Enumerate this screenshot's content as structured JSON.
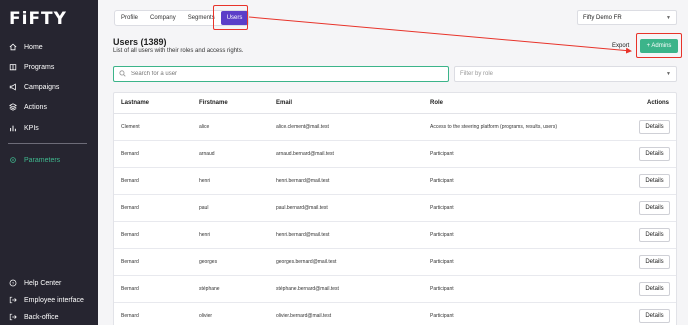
{
  "app": {
    "logo": "FiFTY"
  },
  "sidebar": {
    "items": [
      {
        "label": "Home",
        "icon": "home-icon"
      },
      {
        "label": "Programs",
        "icon": "book-icon"
      },
      {
        "label": "Campaigns",
        "icon": "megaphone-icon"
      },
      {
        "label": "Actions",
        "icon": "layers-icon"
      },
      {
        "label": "KPIs",
        "icon": "chart-icon"
      },
      {
        "label": "Parameters",
        "icon": "gear-icon",
        "active": true
      }
    ],
    "bottom": [
      {
        "label": "Help Center",
        "icon": "help-icon"
      },
      {
        "label": "Employee interface",
        "icon": "logout-icon"
      },
      {
        "label": "Back-office",
        "icon": "logout-icon"
      }
    ]
  },
  "tabs": [
    {
      "label": "Profile"
    },
    {
      "label": "Company"
    },
    {
      "label": "Segments"
    },
    {
      "label": "Users",
      "active": true
    }
  ],
  "org_select": {
    "value": "Fifty Demo FR"
  },
  "page": {
    "title": "Users (1389)",
    "subtitle": "List of all users with their roles and access rights.",
    "export_label": "Export",
    "admins_label": "+ Admins"
  },
  "search": {
    "placeholder": "Search for a user"
  },
  "role_filter": {
    "placeholder": "Filter by role"
  },
  "table": {
    "columns": [
      "Lastname",
      "Firstname",
      "Email",
      "Role",
      "Actions"
    ],
    "details_label": "Details",
    "rows": [
      {
        "lastname": "Clement",
        "firstname": "alice",
        "email": "alice.clement@mail.test",
        "role": "Access to the steering platform (programs, results, users)"
      },
      {
        "lastname": "Bernard",
        "firstname": "arnaud",
        "email": "arnaud.bernard@mail.test",
        "role": "Participant"
      },
      {
        "lastname": "Bernard",
        "firstname": "henri",
        "email": "henri.bernard@mail.test",
        "role": "Participant"
      },
      {
        "lastname": "Bernard",
        "firstname": "paul",
        "email": "paul.bernard@mail.test",
        "role": "Participant"
      },
      {
        "lastname": "Bernard",
        "firstname": "henri",
        "email": "henri.bernard@mail.test",
        "role": "Participant"
      },
      {
        "lastname": "Bernard",
        "firstname": "georges",
        "email": "georges.bernard@mail.test",
        "role": "Participant"
      },
      {
        "lastname": "Bernard",
        "firstname": "stéphane",
        "email": "stéphane.bernard@mail.test",
        "role": "Participant"
      },
      {
        "lastname": "Bernard",
        "firstname": "olivier",
        "email": "olivier.bernard@mail.test",
        "role": "Participant"
      }
    ]
  },
  "colors": {
    "accent": "#3cb48a",
    "tab_active": "#5b3ec8",
    "annotation": "#e8332a",
    "sidebar": "#262530"
  }
}
